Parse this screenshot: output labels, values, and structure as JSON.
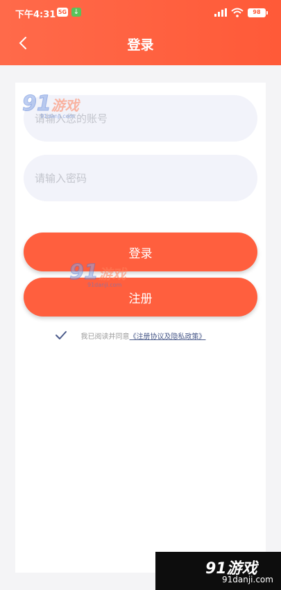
{
  "status_bar": {
    "time": "下午4:31",
    "badge_5g": "5G",
    "badge_download": "↓",
    "battery": "98"
  },
  "header": {
    "title": "登录",
    "back_icon": "chevron-left-icon"
  },
  "form": {
    "account_placeholder": "请输入您的账号",
    "password_placeholder": "请输入密码",
    "login_label": "登录",
    "register_label": "注册"
  },
  "agreement": {
    "prefix": "我已阅读并同意",
    "link": "《注册协议及隐私政策》"
  },
  "watermark": {
    "number": "91",
    "text": "游戏",
    "url": "91danji.com"
  },
  "colors": {
    "accent": "#ff5f3e",
    "input_bg": "#f2f3fa",
    "link": "#4a5a8a"
  }
}
